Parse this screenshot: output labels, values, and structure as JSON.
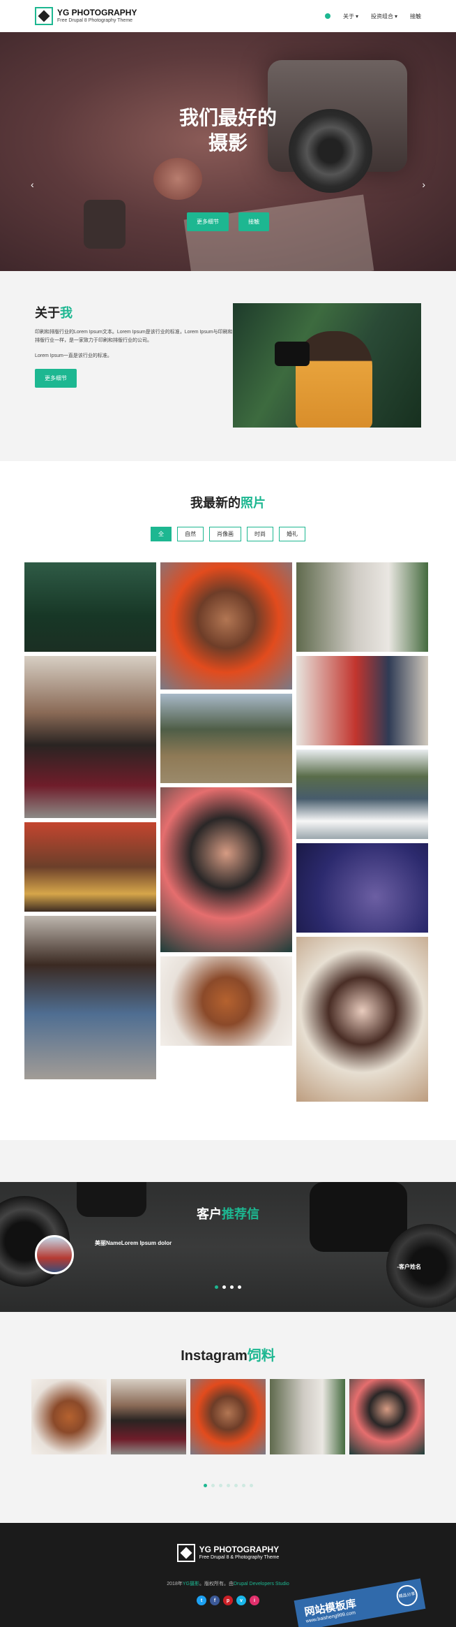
{
  "header": {
    "logo_title": "YG PHOTOGRAPHY",
    "logo_subtitle": "Free Drupal 8 Photography Theme",
    "nav": [
      {
        "label": "关于",
        "has_dropdown": true
      },
      {
        "label": "投资组合",
        "has_dropdown": true
      },
      {
        "label": "接触",
        "has_dropdown": false
      }
    ]
  },
  "hero": {
    "title_line1": "我们最好的",
    "title_line2": "摄影",
    "button1": "更多细节",
    "button2": "接触"
  },
  "about": {
    "title": "关于",
    "title_accent": "我",
    "paragraph1": "印刷和排版行业的Lorem Ipsum文本。Lorem Ipsum是该行业的标准，Lorem Ipsum与印刷和排版行业一样，是一家致力于印刷和排版行业的公司。",
    "paragraph2": "Lorem Ipsum一直是该行业的标准。",
    "button": "更多细节"
  },
  "gallery": {
    "title": "我最新的",
    "title_accent": "照片",
    "filters": [
      "全",
      "自然",
      "肖像画",
      "时尚",
      "婚礼"
    ]
  },
  "testimonial": {
    "title": "客户",
    "title_accent": "推荐信",
    "quote": "美丽NameLorem Ipsum dolor",
    "client": "-客户姓名"
  },
  "instagram": {
    "title": "Instagram",
    "title_accent": "饲料"
  },
  "footer": {
    "logo_title": "YG PHOTOGRAPHY",
    "logo_subtitle": "Free Drupal 8 & Photography Theme",
    "copy_prefix": "2018年",
    "copy_accent1": "YG摄影",
    "copy_mid": "。版权所有。由",
    "copy_accent2": "Drupal Developers Studio",
    "socials": [
      "t",
      "f",
      "p",
      "v",
      "i"
    ],
    "social_colors": [
      "#1da1f2",
      "#3b5998",
      "#cb2027",
      "#1ab7ea",
      "#e1306c"
    ]
  },
  "watermark": {
    "text": "网站模板库",
    "url": "www.baisheng999.com",
    "badge": "精品分享"
  },
  "colors": {
    "accent": "#1db791"
  }
}
